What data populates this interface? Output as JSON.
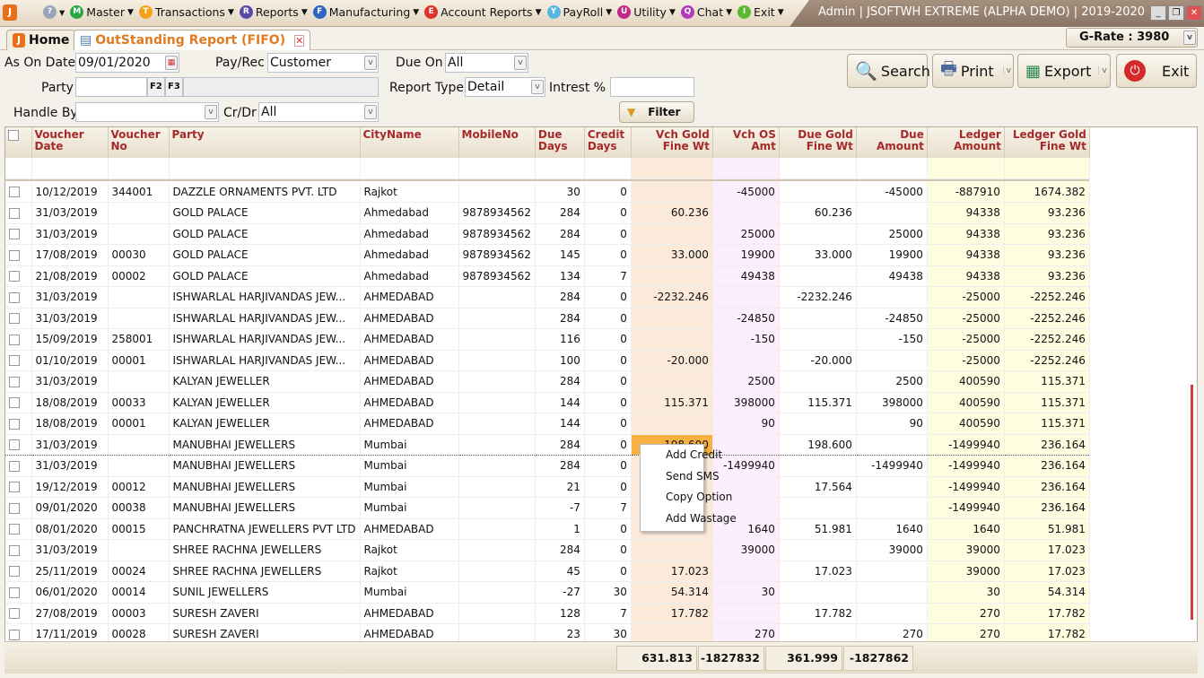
{
  "app": {
    "title": "Admin | JSOFTWH EXTREME (ALPHA DEMO)  | 2019-2020",
    "logo": "J"
  },
  "menu": [
    {
      "label": "Master",
      "icon": "M",
      "color": "#27a844"
    },
    {
      "label": "Transactions",
      "icon": "T",
      "color": "#f2a31b"
    },
    {
      "label": "Reports",
      "icon": "R",
      "color": "#5a4aa8"
    },
    {
      "label": "Manufacturing",
      "icon": "F",
      "color": "#2e64c4"
    },
    {
      "label": "Account Reports",
      "icon": "E",
      "color": "#e0302a"
    },
    {
      "label": "PayRoll",
      "icon": "Y",
      "color": "#57b5e6"
    },
    {
      "label": "Utility",
      "icon": "U",
      "color": "#c2288a"
    },
    {
      "label": "Chat",
      "icon": "Q",
      "color": "#b03ab8"
    },
    {
      "label": "Exit",
      "icon": "I",
      "color": "#5cb82e"
    }
  ],
  "tabs": {
    "home": "Home",
    "report": "OutStanding Report (FIFO)"
  },
  "grate": "G-Rate : 3980",
  "form": {
    "as_on_date_label": "As On Date",
    "as_on_date": "09/01/2020",
    "payrec_label": "Pay/Rec",
    "payrec": "Customer",
    "due_on_label": "Due On",
    "due_on": "All",
    "party_label": "Party",
    "party": "",
    "f2": "F2",
    "f3": "F3",
    "report_type_label": "Report Type",
    "report_type": "Detail",
    "interest_label": "Intrest %",
    "interest": "",
    "handle_by_label": "Handle By",
    "handle_by": "",
    "crdr_label": "Cr/Dr",
    "crdr": "All",
    "filter": "Filter"
  },
  "buttons": {
    "search": "Search",
    "print": "Print",
    "export": "Export",
    "exit": "Exit"
  },
  "columns": [
    "Voucher Date",
    "Voucher No",
    "Party",
    "CityName",
    "MobileNo",
    "Due Days",
    "Credit Days",
    "Vch Gold Fine Wt",
    "Vch OS Amt",
    "Due Gold Fine Wt",
    "Due Amount",
    "Ledger Amount",
    "Ledger Gold Fine Wt"
  ],
  "rows": [
    [
      "10/12/2019",
      "344001",
      "DAZZLE ORNAMENTS PVT. LTD",
      "Rajkot",
      "",
      "30",
      "0",
      "",
      "-45000",
      "",
      "-45000",
      "-887910",
      "1674.382"
    ],
    [
      "31/03/2019",
      "",
      "GOLD PALACE",
      "Ahmedabad",
      "9878934562",
      "284",
      "0",
      "60.236",
      "",
      "60.236",
      "",
      "94338",
      "93.236"
    ],
    [
      "31/03/2019",
      "",
      "GOLD PALACE",
      "Ahmedabad",
      "9878934562",
      "284",
      "0",
      "",
      "25000",
      "",
      "25000",
      "94338",
      "93.236"
    ],
    [
      "17/08/2019",
      "00030",
      "GOLD PALACE",
      "Ahmedabad",
      "9878934562",
      "145",
      "0",
      "33.000",
      "19900",
      "33.000",
      "19900",
      "94338",
      "93.236"
    ],
    [
      "21/08/2019",
      "00002",
      "GOLD PALACE",
      "Ahmedabad",
      "9878934562",
      "134",
      "7",
      "",
      "49438",
      "",
      "49438",
      "94338",
      "93.236"
    ],
    [
      "31/03/2019",
      "",
      "ISHWARLAL HARJIVANDAS JEW...",
      "AHMEDABAD",
      "",
      "284",
      "0",
      "-2232.246",
      "",
      "-2232.246",
      "",
      "-25000",
      "-2252.246"
    ],
    [
      "31/03/2019",
      "",
      "ISHWARLAL HARJIVANDAS JEW...",
      "AHMEDABAD",
      "",
      "284",
      "0",
      "",
      "-24850",
      "",
      "-24850",
      "-25000",
      "-2252.246"
    ],
    [
      "15/09/2019",
      "258001",
      "ISHWARLAL HARJIVANDAS JEW...",
      "AHMEDABAD",
      "",
      "116",
      "0",
      "",
      "-150",
      "",
      "-150",
      "-25000",
      "-2252.246"
    ],
    [
      "01/10/2019",
      "00001",
      "ISHWARLAL HARJIVANDAS JEW...",
      "AHMEDABAD",
      "",
      "100",
      "0",
      "-20.000",
      "",
      "-20.000",
      "",
      "-25000",
      "-2252.246"
    ],
    [
      "31/03/2019",
      "",
      "KALYAN JEWELLER",
      "AHMEDABAD",
      "",
      "284",
      "0",
      "",
      "2500",
      "",
      "2500",
      "400590",
      "115.371"
    ],
    [
      "18/08/2019",
      "00033",
      "KALYAN JEWELLER",
      "AHMEDABAD",
      "",
      "144",
      "0",
      "115.371",
      "398000",
      "115.371",
      "398000",
      "400590",
      "115.371"
    ],
    [
      "18/08/2019",
      "00001",
      "KALYAN JEWELLER",
      "AHMEDABAD",
      "",
      "144",
      "0",
      "",
      "90",
      "",
      "90",
      "400590",
      "115.371"
    ],
    [
      "31/03/2019",
      "",
      "MANUBHAI JEWELLERS",
      "Mumbai",
      "",
      "284",
      "0",
      "198.600",
      "",
      "198.600",
      "",
      "-1499940",
      "236.164"
    ],
    [
      "31/03/2019",
      "",
      "MANUBHAI JEWELLERS",
      "Mumbai",
      "",
      "284",
      "0",
      "",
      "-1499940",
      "",
      "-1499940",
      "-1499940",
      "236.164"
    ],
    [
      "19/12/2019",
      "00012",
      "MANUBHAI JEWELLERS",
      "Mumbai",
      "",
      "21",
      "0",
      "",
      "",
      "17.564",
      "",
      "-1499940",
      "236.164"
    ],
    [
      "09/01/2020",
      "00038",
      "MANUBHAI JEWELLERS",
      "Mumbai",
      "",
      "-7",
      "7",
      "",
      "",
      "",
      "",
      "-1499940",
      "236.164"
    ],
    [
      "08/01/2020",
      "00015",
      "PANCHRATNA JEWELLERS PVT LTD",
      "AHMEDABAD",
      "",
      "1",
      "0",
      "",
      "1640",
      "51.981",
      "1640",
      "1640",
      "51.981"
    ],
    [
      "31/03/2019",
      "",
      "SHREE RACHNA JEWELLERS",
      "Rajkot",
      "",
      "284",
      "0",
      "",
      "39000",
      "",
      "39000",
      "39000",
      "17.023"
    ],
    [
      "25/11/2019",
      "00024",
      "SHREE RACHNA JEWELLERS",
      "Rajkot",
      "",
      "45",
      "0",
      "17.023",
      "",
      "17.023",
      "",
      "39000",
      "17.023"
    ],
    [
      "06/01/2020",
      "00014",
      "SUNIL JEWELLERS",
      "Mumbai",
      "",
      "-27",
      "30",
      "54.314",
      "30",
      "",
      "",
      "30",
      "54.314"
    ],
    [
      "27/08/2019",
      "00003",
      "SURESH ZAVERI",
      "AHMEDABAD",
      "",
      "128",
      "7",
      "17.782",
      "",
      "17.782",
      "",
      "270",
      "17.782"
    ],
    [
      "17/11/2019",
      "00028",
      "SURESH ZAVERI",
      "AHMEDABAD",
      "",
      "23",
      "30",
      "",
      "270",
      "",
      "270",
      "270",
      "17.782"
    ]
  ],
  "selected_row": 12,
  "context_menu": [
    "Add Credit",
    "Send SMS",
    "Copy Option",
    "Add Wastage"
  ],
  "totals": {
    "vch_gold": "631.813",
    "vch_os": "-1827832",
    "due_gold": "361.999",
    "due_amount": "-1827862"
  }
}
